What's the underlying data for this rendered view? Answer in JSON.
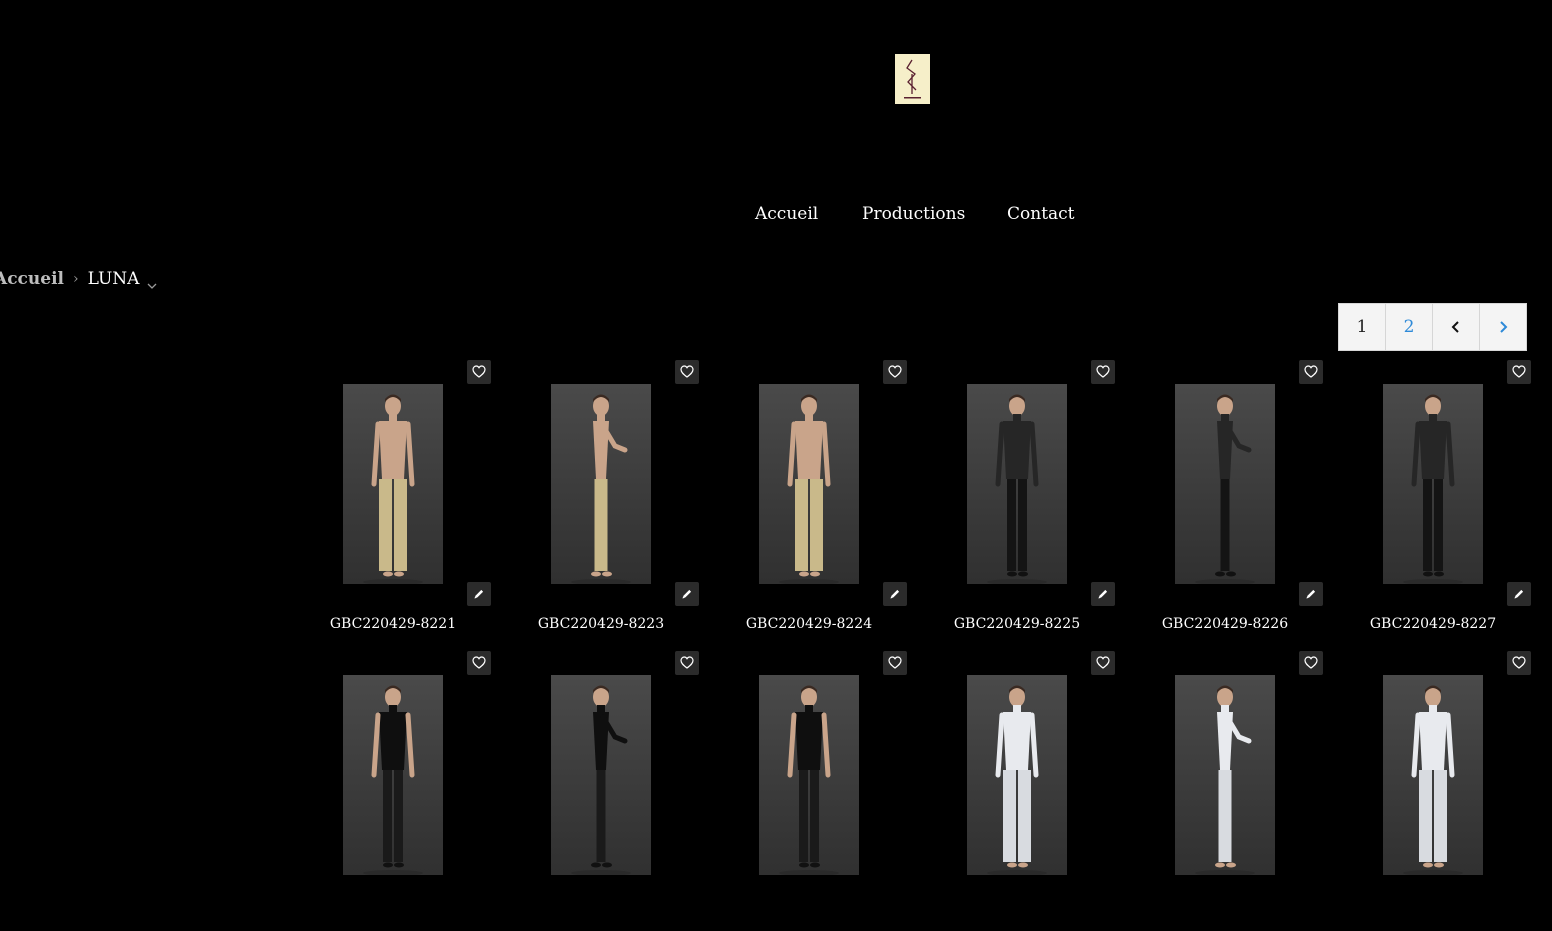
{
  "nav": {
    "items": [
      "Accueil",
      "Productions",
      "Contact"
    ]
  },
  "breadcrumb": {
    "home": "Accueil",
    "current": "LUNA"
  },
  "pagination": {
    "pages": [
      "1",
      "2"
    ],
    "current": "1",
    "prev_icon": "chevron-left-icon",
    "next_icon": "chevron-right-icon"
  },
  "gallery": {
    "favorite_icon": "heart-icon",
    "edit_icon": "pencil-icon",
    "items": [
      {
        "caption": "GBC220429-8221",
        "view": "front",
        "top": "#dcc9a7",
        "bottom": "#c9b98a",
        "bottom_style": "pants"
      },
      {
        "caption": "GBC220429-8223",
        "view": "side",
        "top": "#dcc9a7",
        "bottom": "#c9b98a",
        "bottom_style": "pants"
      },
      {
        "caption": "GBC220429-8224",
        "view": "back",
        "top": "#dcc9a7",
        "bottom": "#c9b98a",
        "bottom_style": "pants"
      },
      {
        "caption": "GBC220429-8225",
        "view": "front",
        "top": "#262626",
        "bottom": "#141414",
        "bottom_style": "leggings"
      },
      {
        "caption": "GBC220429-8226",
        "view": "side",
        "top": "#262626",
        "bottom": "#141414",
        "bottom_style": "leggings"
      },
      {
        "caption": "GBC220429-8227",
        "view": "back",
        "top": "#262626",
        "bottom": "#141414",
        "bottom_style": "leggings"
      },
      {
        "caption": "",
        "view": "front",
        "top": "#0f0f0f",
        "bottom": "#1a1a1a",
        "bottom_style": "leggings"
      },
      {
        "caption": "",
        "view": "side",
        "top": "#0f0f0f",
        "bottom": "#1a1a1a",
        "bottom_style": "leggings"
      },
      {
        "caption": "",
        "view": "back",
        "top": "#0f0f0f",
        "bottom": "#1a1a1a",
        "bottom_style": "leggings"
      },
      {
        "caption": "",
        "view": "front",
        "top": "#e8eaee",
        "bottom": "#d8dbe0",
        "bottom_style": "pants"
      },
      {
        "caption": "",
        "view": "side",
        "top": "#e8eaee",
        "bottom": "#d8dbe0",
        "bottom_style": "pants"
      },
      {
        "caption": "",
        "view": "back",
        "top": "#e8eaee",
        "bottom": "#d8dbe0",
        "bottom_style": "pants"
      }
    ]
  }
}
